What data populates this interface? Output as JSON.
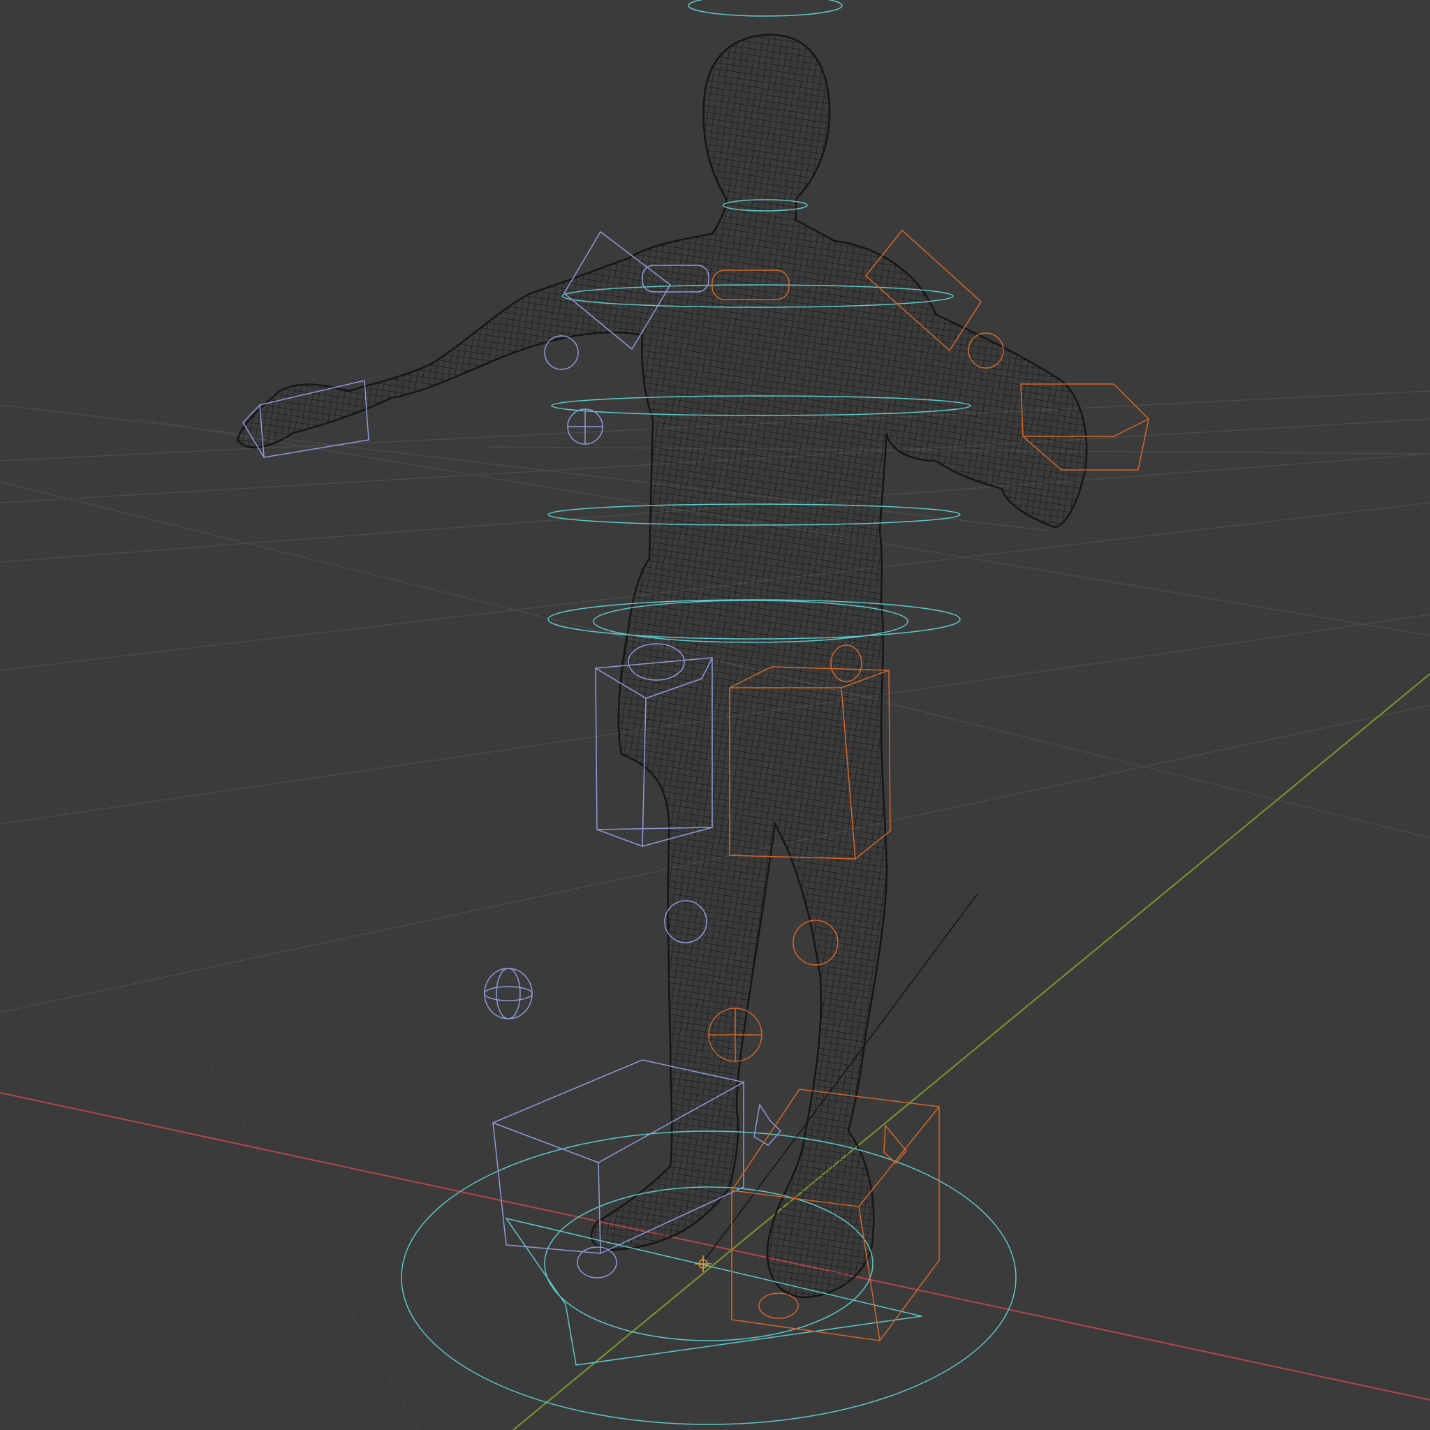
{
  "viewport": {
    "name": "3D Viewport",
    "shading_mode": "wireframe",
    "background_color": "#3b3b3b"
  },
  "colors": {
    "grid": "#4a4a4a",
    "axis_x": "#b3474e",
    "axis_y": "#7a9a2c",
    "mesh_wire": "#111111",
    "control_center": "#5fc8c8",
    "control_left": "#8f9bd9",
    "control_right": "#d2692a",
    "cursor": "#e6a23c"
  },
  "scene": {
    "object": "character-mesh",
    "rig_controls": {
      "center": [
        "head-ring-control",
        "neck-ring-control",
        "shoulders-ring-control",
        "chest-ring-control",
        "spine-ring-control",
        "hips-ring-control",
        "root-circle-control",
        "master-circle-control"
      ],
      "left": [
        "shoulder-left-control",
        "clavicle-left-control",
        "elbow-left-control",
        "hand-left-control",
        "arm-pole-left-control",
        "thigh-left-control",
        "knee-left-control",
        "leg-pole-left-control",
        "foot-left-control",
        "heel-left-control"
      ],
      "right": [
        "shoulder-right-control",
        "clavicle-right-control",
        "elbow-right-control",
        "hand-right-control",
        "thigh-right-control",
        "knee-right-control",
        "leg-pole-right-control",
        "foot-right-control",
        "heel-right-control"
      ]
    }
  }
}
